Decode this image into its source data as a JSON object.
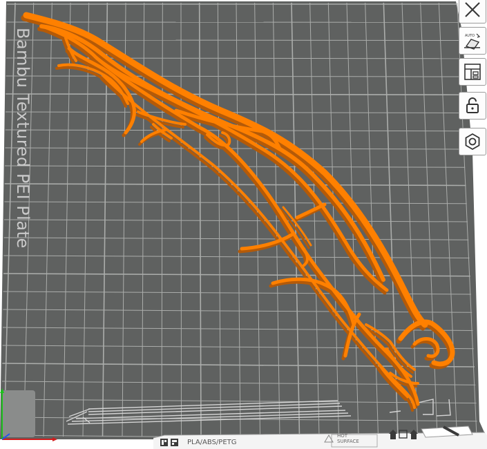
{
  "plate": {
    "name": "Bambu Textured PEI Plate",
    "filament_label": "PLA/ABS/PETG",
    "hot_surface_label": "HOT SURFACE",
    "hot_surface_lines": [
      "HOT",
      "SURFACE"
    ]
  },
  "toolbar": {
    "buttons": [
      {
        "name": "close-button",
        "icon": "close-icon"
      },
      {
        "name": "auto-orient-button",
        "icon": "auto-orient-icon",
        "label": "AUTO"
      },
      {
        "name": "arrange-button",
        "icon": "arrange-icon"
      },
      {
        "name": "lock-button",
        "icon": "lock-icon"
      },
      {
        "name": "settings-button",
        "icon": "hex-nut-icon"
      }
    ]
  },
  "colors": {
    "plate": "#5f6160",
    "grid": "#c7c9c7",
    "model": "#ff7f00",
    "model_shadow": "#b85700",
    "background": "#ffffff"
  }
}
